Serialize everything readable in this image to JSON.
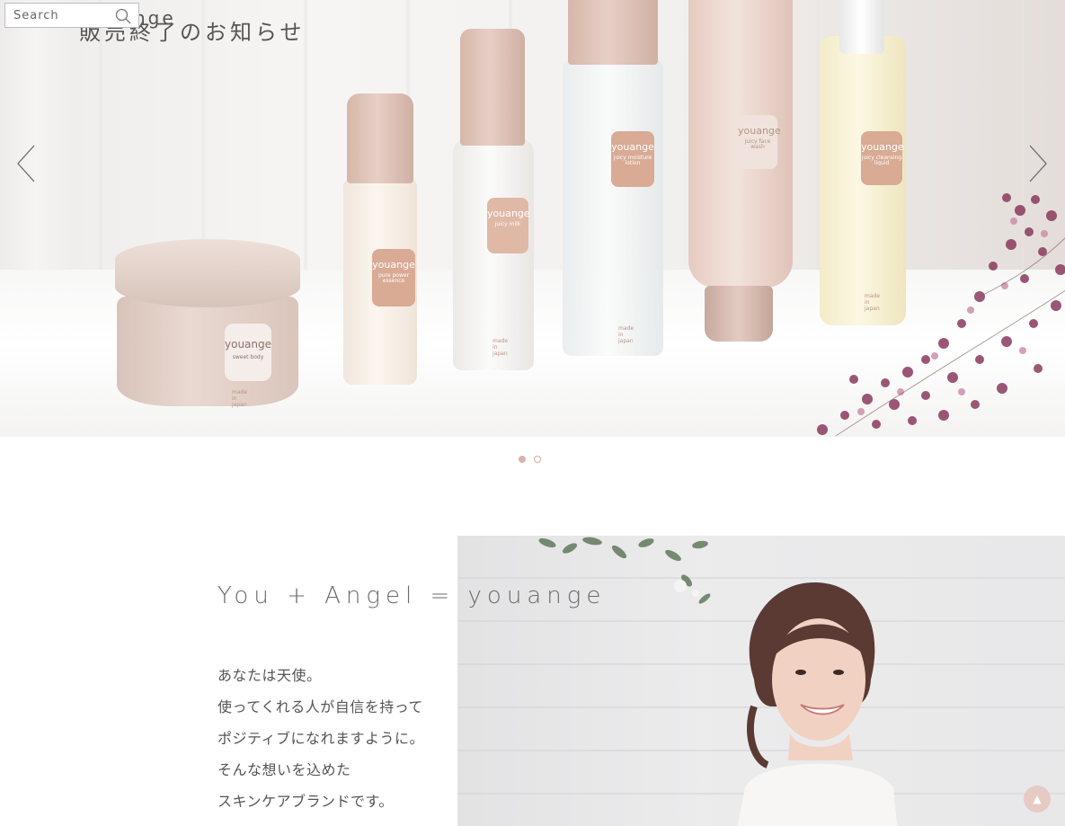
{
  "search": {
    "placeholder": "Search"
  },
  "hero": {
    "title_top": "youange",
    "title": "販売終了のお知らせ",
    "products": {
      "jar": {
        "brand": "youange",
        "sub": "sweet body",
        "made": "made in japan"
      },
      "essence": {
        "brand": "youange",
        "sub": "pure power essence"
      },
      "milk": {
        "brand": "youange",
        "sub": "juicy milk",
        "made": "made in japan"
      },
      "lotion": {
        "brand": "youange",
        "sub": "juicy moisture lotion",
        "made": "made in japan"
      },
      "tube": {
        "brand": "youange",
        "sub": "juicy face wash"
      },
      "oil": {
        "brand": "youange",
        "sub": "juicy cleansing liquid",
        "made": "made in japan"
      }
    },
    "slide_count": 2,
    "active_slide": 1
  },
  "brand": {
    "tagline": "You + Angel = youange",
    "copy": [
      "あなたは天使。",
      "使ってくれる人が自信を持って",
      "ポジティブになれますように。",
      "そんな想いを込めた",
      "スキンケアブランドです。"
    ]
  },
  "to_top": {
    "glyph": "▲"
  },
  "colors": {
    "accent": "#d9b4ae",
    "label": "#d9aa94",
    "text": "#555555"
  }
}
